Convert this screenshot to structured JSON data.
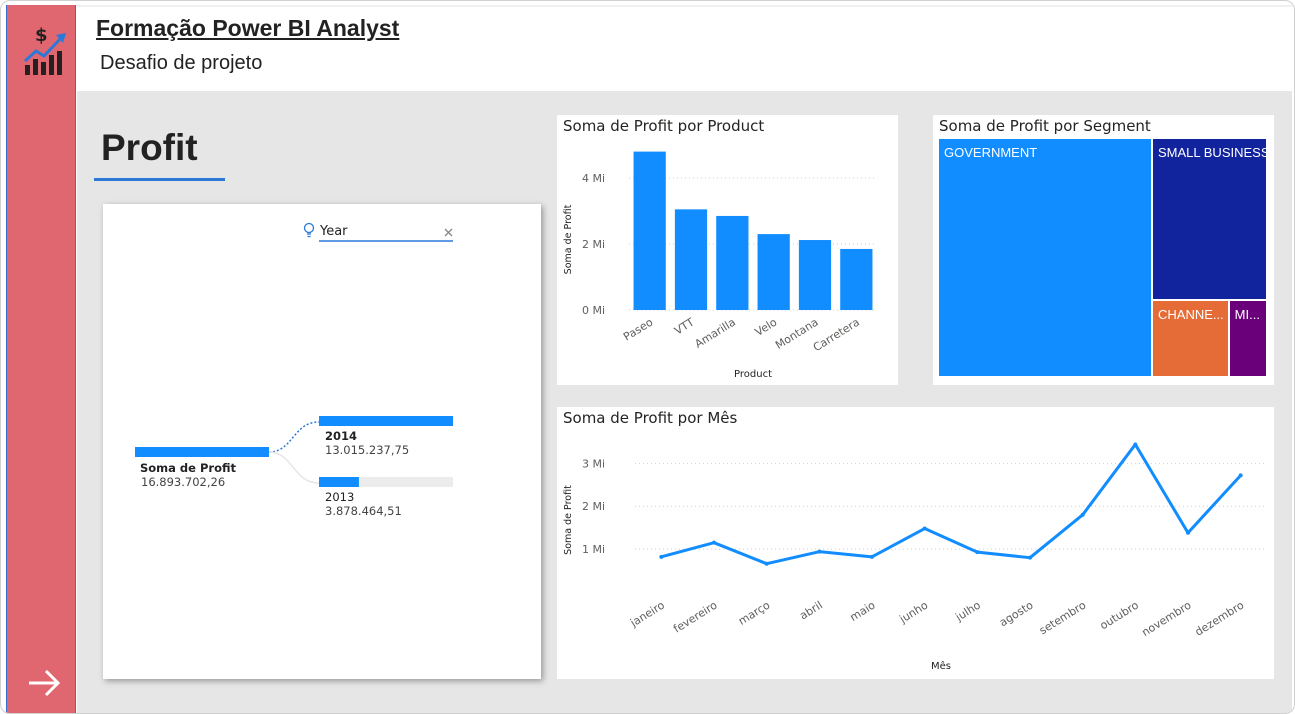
{
  "header": {
    "title": "Formação Power BI Analyst",
    "subtitle": "Desafio de projeto"
  },
  "sidebar": {
    "logo_icon": "money-chart-icon",
    "next_icon": "arrow-right-icon"
  },
  "page_heading": "Profit",
  "decomposition": {
    "filter_label": "Year",
    "root": {
      "label": "Soma de Profit",
      "value": "16.893.702,26"
    },
    "children": [
      {
        "label": "2014",
        "value": "13.015.237,75",
        "fraction": 1.0,
        "selected": true
      },
      {
        "label": "2013",
        "value": "3.878.464,51",
        "fraction": 0.298,
        "selected": false
      }
    ]
  },
  "colors": {
    "accent": "#118dff",
    "sidebar": "#e0666f",
    "dark_blue": "#12239e",
    "orange": "#e66c37",
    "purple": "#6b007b"
  },
  "chart_data": [
    {
      "type": "bar",
      "title": "Soma de Profit por Product",
      "xlabel": "Product",
      "ylabel": "Soma de Profit",
      "categories": [
        "Paseo",
        "VTT",
        "Amarilla",
        "Velo",
        "Montana",
        "Carretera"
      ],
      "values": [
        4.8,
        3.05,
        2.85,
        2.3,
        2.12,
        1.85
      ],
      "ylim": [
        0,
        5
      ],
      "ticks": [
        0,
        2,
        4
      ],
      "tick_labels": [
        "0 Mi",
        "2 Mi",
        "4 Mi"
      ],
      "grid": true
    },
    {
      "type": "treemap",
      "title": "Soma de Profit por Segment",
      "categories": [
        "GOVERNMENT",
        "SMALL BUSINESS",
        "CHANNEL PARTNERS",
        "MIDMARKET"
      ],
      "labels": [
        "GOVERNMENT",
        "SMALL BUSINESS",
        "CHANNE...",
        "MI..."
      ],
      "values": [
        11.39,
        4.14,
        1.32,
        0.66
      ]
    },
    {
      "type": "line",
      "title": "Soma de Profit por Mês",
      "xlabel": "Mês",
      "ylabel": "Soma de Profit",
      "categories": [
        "janeiro",
        "fevereiro",
        "março",
        "abril",
        "maio",
        "junho",
        "julho",
        "agosto",
        "setembro",
        "outubro",
        "novembro",
        "dezembro"
      ],
      "values": [
        0.82,
        1.15,
        0.66,
        0.94,
        0.82,
        1.48,
        0.93,
        0.8,
        1.8,
        3.44,
        1.38,
        2.72
      ],
      "ylim": [
        0,
        3.8
      ],
      "ticks": [
        1,
        2,
        3
      ],
      "tick_labels": [
        "1 Mi",
        "2 Mi",
        "3 Mi"
      ],
      "grid": true
    }
  ]
}
